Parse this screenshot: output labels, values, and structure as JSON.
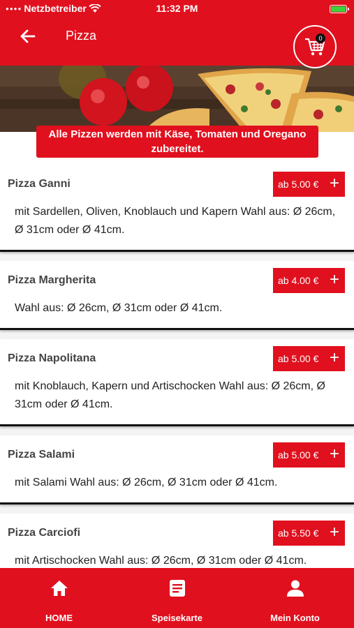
{
  "status_bar": {
    "carrier": "Netzbetreiber",
    "time": "11:32 PM"
  },
  "header": {
    "title": "Pizza",
    "cart_count": "0"
  },
  "info_banner": "Alle Pizzen werden mit Käse, Tomaten und Oregano zubereitet.",
  "items": [
    {
      "name": "Pizza Ganni",
      "price": "ab 5.00 €",
      "description": "mit Sardellen, Oliven, Knoblauch und Kapern Wahl aus: Ø 26cm, Ø 31cm oder Ø 41cm."
    },
    {
      "name": "Pizza Margherita",
      "price": "ab 4.00 €",
      "description": "Wahl aus: Ø 26cm, Ø 31cm oder Ø 41cm."
    },
    {
      "name": "Pizza Napolitana",
      "price": "ab 5.00 €",
      "description": "mit Knoblauch, Kapern und Artischocken Wahl aus: Ø 26cm, Ø 31cm oder Ø 41cm."
    },
    {
      "name": "Pizza Salami",
      "price": "ab 5.00 €",
      "description": "mit Salami Wahl aus: Ø 26cm, Ø 31cm oder Ø 41cm."
    },
    {
      "name": "Pizza Carciofi",
      "price": "ab 5.50 €",
      "description": "mit Artischocken Wahl aus: Ø 26cm, Ø 31cm oder Ø 41cm."
    }
  ],
  "nav": [
    {
      "label": "HOME",
      "icon": "home-icon"
    },
    {
      "label": "Speisekarte",
      "icon": "menu-icon"
    },
    {
      "label": "Mein Konto",
      "icon": "account-icon"
    }
  ],
  "colors": {
    "brand": "#e1101e",
    "text": "#222222",
    "title": "#444444"
  }
}
